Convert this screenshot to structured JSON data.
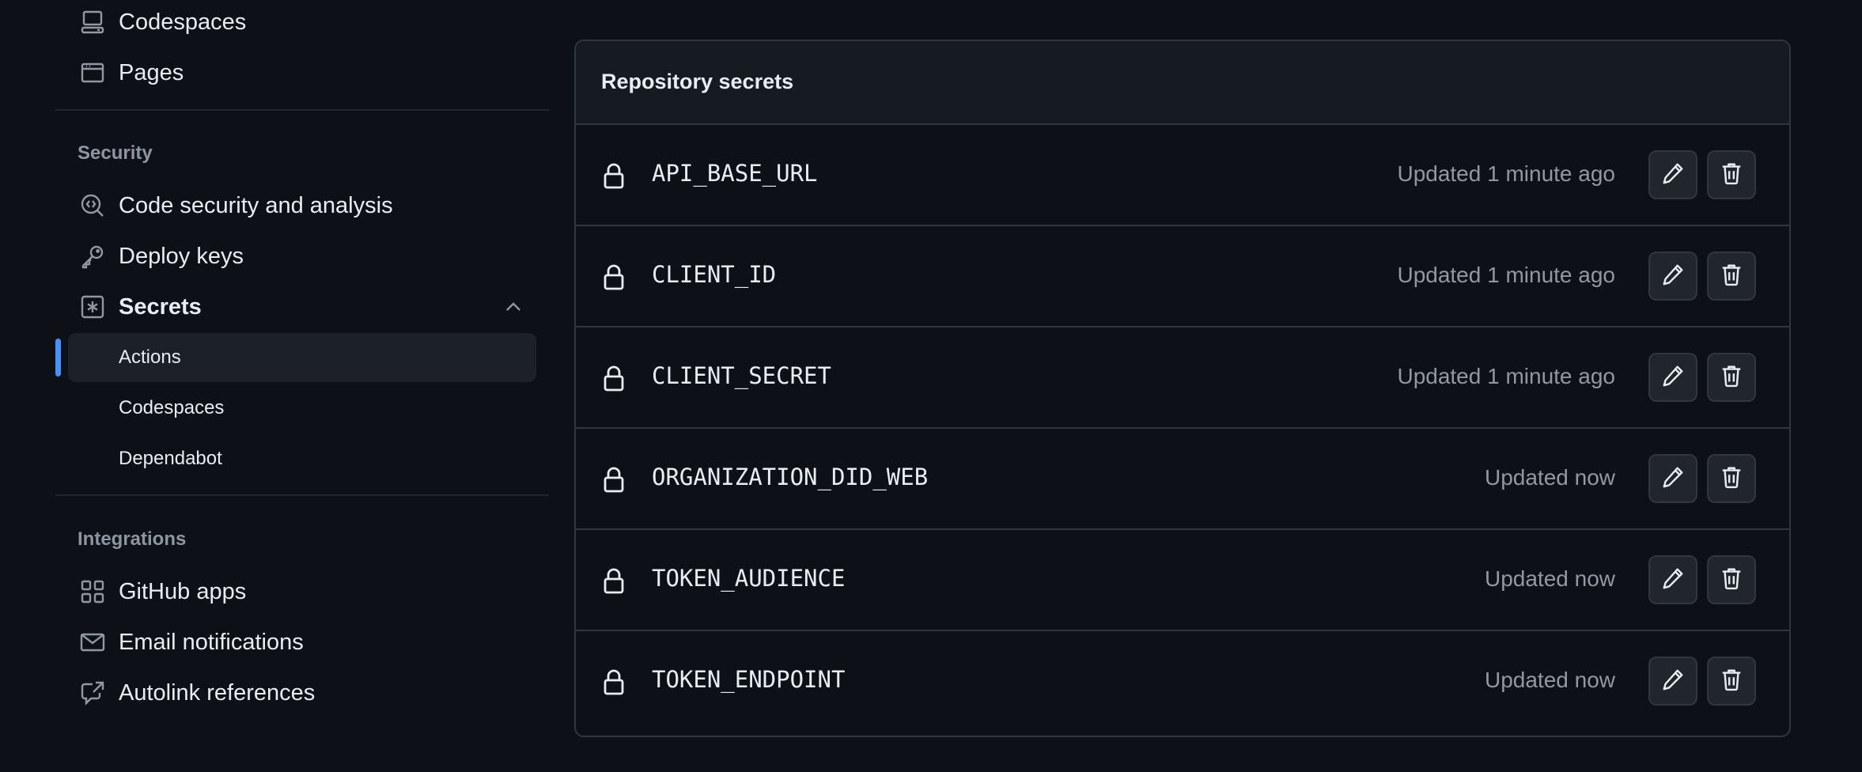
{
  "sidebar": {
    "items_top": [
      {
        "label": "Codespaces",
        "icon": "codespaces-icon"
      },
      {
        "label": "Pages",
        "icon": "browser-icon"
      }
    ],
    "security": {
      "heading": "Security",
      "items": [
        {
          "label": "Code security and analysis",
          "icon": "codescan-icon"
        },
        {
          "label": "Deploy keys",
          "icon": "key-icon"
        },
        {
          "label": "Secrets",
          "icon": "secrets-icon",
          "expanded": true
        }
      ],
      "secrets_sub": [
        {
          "label": "Actions",
          "active": true
        },
        {
          "label": "Codespaces",
          "active": false
        },
        {
          "label": "Dependabot",
          "active": false
        }
      ]
    },
    "integrations": {
      "heading": "Integrations",
      "items": [
        {
          "label": "GitHub apps",
          "icon": "apps-icon"
        },
        {
          "label": "Email notifications",
          "icon": "mail-icon"
        },
        {
          "label": "Autolink references",
          "icon": "cross-reference-icon"
        }
      ]
    }
  },
  "secrets_panel": {
    "title": "Repository secrets",
    "rows": [
      {
        "name": "API_BASE_URL",
        "updated": "Updated 1 minute ago"
      },
      {
        "name": "CLIENT_ID",
        "updated": "Updated 1 minute ago"
      },
      {
        "name": "CLIENT_SECRET",
        "updated": "Updated 1 minute ago"
      },
      {
        "name": "ORGANIZATION_DID_WEB",
        "updated": "Updated now"
      },
      {
        "name": "TOKEN_AUDIENCE",
        "updated": "Updated now"
      },
      {
        "name": "TOKEN_ENDPOINT",
        "updated": "Updated now"
      }
    ]
  },
  "colors": {
    "background": "#0d1117",
    "border": "#30363d",
    "accent": "#4493f8",
    "muted_text": "#9198a1"
  }
}
